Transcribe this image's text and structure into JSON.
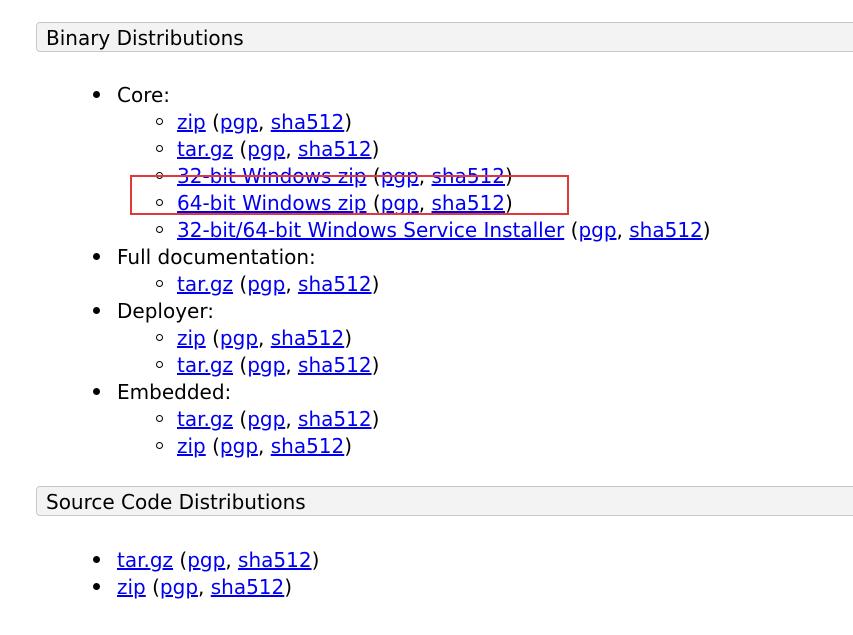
{
  "headers": {
    "binary": "Binary Distributions",
    "source": "Source Code Distributions"
  },
  "binary": {
    "core": {
      "label": "Core:",
      "items": [
        {
          "link": "zip",
          "pgp": "pgp",
          "sha": "sha512"
        },
        {
          "link": "tar.gz",
          "pgp": "pgp",
          "sha": "sha512"
        },
        {
          "link": "32-bit Windows zip",
          "pgp": "pgp",
          "sha": "sha512"
        },
        {
          "link": "64-bit Windows zip",
          "pgp": "pgp",
          "sha": "sha512"
        },
        {
          "link": "32-bit/64-bit Windows Service Installer",
          "pgp": "pgp",
          "sha": "sha512"
        }
      ]
    },
    "fulldoc": {
      "label": "Full documentation:",
      "items": [
        {
          "link": "tar.gz",
          "pgp": "pgp",
          "sha": "sha512"
        }
      ]
    },
    "deployer": {
      "label": "Deployer:",
      "items": [
        {
          "link": "zip",
          "pgp": "pgp",
          "sha": "sha512"
        },
        {
          "link": "tar.gz",
          "pgp": "pgp",
          "sha": "sha512"
        }
      ]
    },
    "embedded": {
      "label": "Embedded:",
      "items": [
        {
          "link": "tar.gz",
          "pgp": "pgp",
          "sha": "sha512"
        },
        {
          "link": "zip",
          "pgp": "pgp",
          "sha": "sha512"
        }
      ]
    }
  },
  "source": {
    "items": [
      {
        "link": "tar.gz",
        "pgp": "pgp",
        "sha": "sha512"
      },
      {
        "link": "zip",
        "pgp": "pgp",
        "sha": "sha512"
      }
    ]
  },
  "punct": {
    "open": " (",
    "comma": ", ",
    "close": ")"
  },
  "highlight_color": "#e0383b",
  "link_color": "#0000ee"
}
